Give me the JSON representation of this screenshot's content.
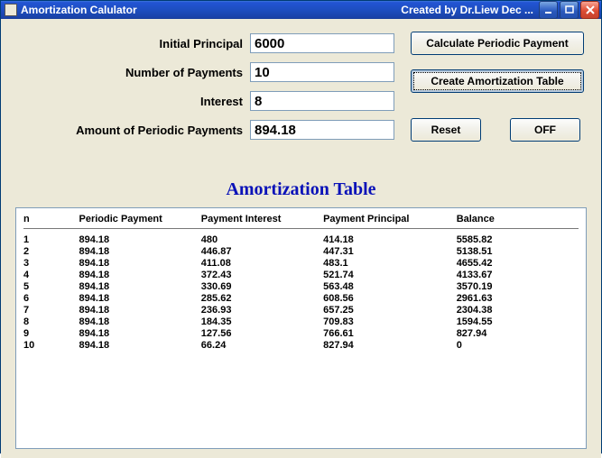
{
  "window": {
    "title": "Amortization Calulator",
    "credit": "Created by Dr.Liew   Dec ..."
  },
  "form": {
    "initial_principal_label": "Initial Principal",
    "initial_principal_value": "6000",
    "num_payments_label": "Number of Payments",
    "num_payments_value": "10",
    "interest_label": "Interest",
    "interest_value": "8",
    "periodic_amount_label": "Amount of Periodic Payments",
    "periodic_amount_value": "894.18"
  },
  "buttons": {
    "calc": "Calculate Periodic Payment",
    "create": "Create Amortization Table",
    "reset": "Reset",
    "off": "OFF"
  },
  "table": {
    "title": "Amortization Table",
    "headers": {
      "n": "n",
      "periodic": "Periodic Payment",
      "interest": "Payment Interest",
      "principal": "Payment Principal",
      "balance": "Balance"
    },
    "rows": [
      {
        "n": "1",
        "periodic": "894.18",
        "interest": "480",
        "principal": "414.18",
        "balance": "5585.82"
      },
      {
        "n": "2",
        "periodic": "894.18",
        "interest": "446.87",
        "principal": "447.31",
        "balance": "5138.51"
      },
      {
        "n": "3",
        "periodic": "894.18",
        "interest": "411.08",
        "principal": "483.1",
        "balance": "4655.42"
      },
      {
        "n": "4",
        "periodic": "894.18",
        "interest": "372.43",
        "principal": "521.74",
        "balance": "4133.67"
      },
      {
        "n": "5",
        "periodic": "894.18",
        "interest": "330.69",
        "principal": "563.48",
        "balance": "3570.19"
      },
      {
        "n": "6",
        "periodic": "894.18",
        "interest": "285.62",
        "principal": "608.56",
        "balance": "2961.63"
      },
      {
        "n": "7",
        "periodic": "894.18",
        "interest": "236.93",
        "principal": "657.25",
        "balance": "2304.38"
      },
      {
        "n": "8",
        "periodic": "894.18",
        "interest": "184.35",
        "principal": "709.83",
        "balance": "1594.55"
      },
      {
        "n": "9",
        "periodic": "894.18",
        "interest": "127.56",
        "principal": "766.61",
        "balance": "827.94"
      },
      {
        "n": "10",
        "periodic": "894.18",
        "interest": "66.24",
        "principal": "827.94",
        "balance": "0"
      }
    ]
  },
  "chart_data": {
    "type": "table",
    "title": "Amortization Table",
    "columns": [
      "n",
      "Periodic Payment",
      "Payment Interest",
      "Payment Principal",
      "Balance"
    ],
    "rows": [
      [
        1,
        894.18,
        480,
        414.18,
        5585.82
      ],
      [
        2,
        894.18,
        446.87,
        447.31,
        5138.51
      ],
      [
        3,
        894.18,
        411.08,
        483.1,
        4655.42
      ],
      [
        4,
        894.18,
        372.43,
        521.74,
        4133.67
      ],
      [
        5,
        894.18,
        330.69,
        563.48,
        3570.19
      ],
      [
        6,
        894.18,
        285.62,
        608.56,
        2961.63
      ],
      [
        7,
        894.18,
        236.93,
        657.25,
        2304.38
      ],
      [
        8,
        894.18,
        184.35,
        709.83,
        1594.55
      ],
      [
        9,
        894.18,
        127.56,
        766.61,
        827.94
      ],
      [
        10,
        894.18,
        66.24,
        827.94,
        0
      ]
    ]
  }
}
